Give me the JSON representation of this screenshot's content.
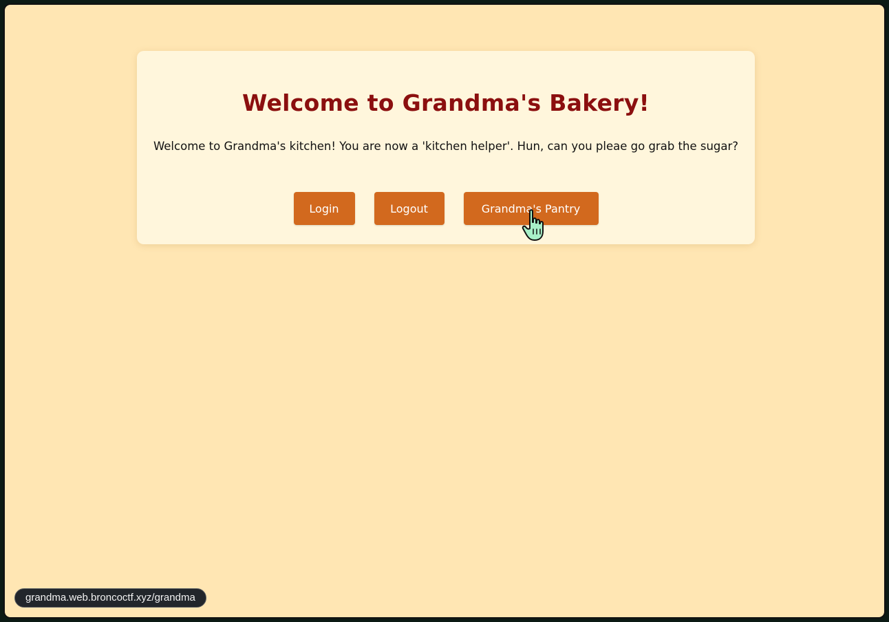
{
  "page": {
    "background": "#ffe6b3",
    "card_background": "#fff6dc",
    "accent": "#d2691e",
    "title_color": "#8b0f0f"
  },
  "header": {
    "title": "Welcome to Grandma's Bakery!"
  },
  "main": {
    "intro_text": "Welcome to Grandma's kitchen! You are now a 'kitchen helper'. Hun, can you pleae go grab the sugar?"
  },
  "buttons": {
    "login_label": "Login",
    "logout_label": "Logout",
    "pantry_label": "Grandma's Pantry"
  },
  "status_bar": {
    "url": "grandma.web.broncoctf.xyz/grandma"
  },
  "cursor": {
    "icon": "hand-pointer-icon",
    "color": "#a8f0c8"
  }
}
